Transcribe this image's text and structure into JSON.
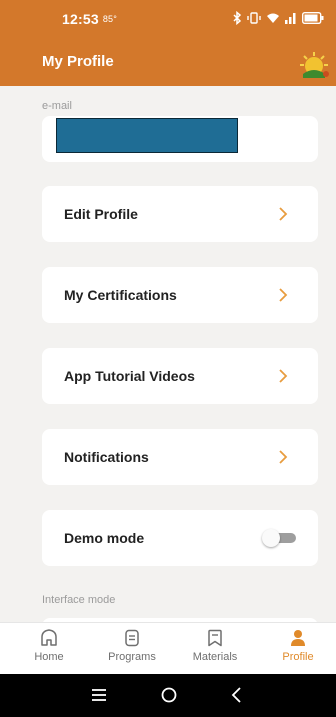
{
  "status_bar": {
    "time": "12:53",
    "temp": "85°"
  },
  "app_bar": {
    "title": "My Profile",
    "logo_icon": "profile-logo"
  },
  "email": {
    "label": "e-mail"
  },
  "menu": [
    {
      "label": "Edit Profile"
    },
    {
      "label": "My Certifications"
    },
    {
      "label": "App Tutorial Videos"
    },
    {
      "label": "Notifications"
    }
  ],
  "demo_mode": {
    "label": "Demo mode",
    "enabled": false
  },
  "interface_mode": {
    "label": "Interface mode"
  },
  "bottom_nav": [
    {
      "label": "Home",
      "icon": "home-icon"
    },
    {
      "label": "Programs",
      "icon": "programs-icon"
    },
    {
      "label": "Materials",
      "icon": "materials-icon"
    },
    {
      "label": "Profile",
      "icon": "person-icon",
      "active": true
    }
  ],
  "colors": {
    "accent": "#d3782b",
    "chevron": "#e89c3f",
    "active_nav": "#e08a2a",
    "redaction": "#1f6d95"
  }
}
